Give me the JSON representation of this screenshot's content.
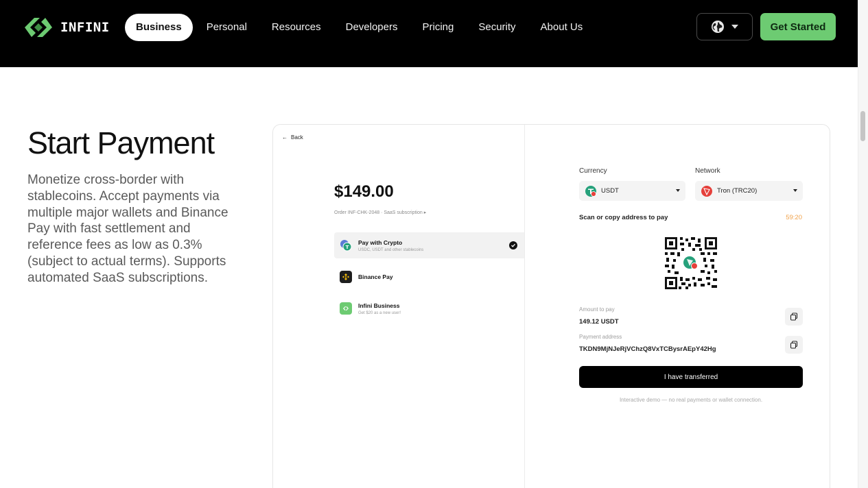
{
  "brand": {
    "name": "INFINI",
    "accent": "#6dcb72"
  },
  "nav": {
    "links": [
      {
        "label": "Business",
        "active": true
      },
      {
        "label": "Personal",
        "active": false
      },
      {
        "label": "Resources",
        "active": false
      },
      {
        "label": "Developers",
        "active": false
      },
      {
        "label": "Pricing",
        "active": false
      },
      {
        "label": "Security",
        "active": false
      },
      {
        "label": "About Us",
        "active": false
      }
    ],
    "language_icon": "globe-icon",
    "cta_label": "Get Started"
  },
  "hero": {
    "title": "Start Payment",
    "description": "Monetize cross-border with stablecoins. Accept payments via multiple major wallets and Binance Pay with fast settlement and reference fees as low as 0.3% (subject to actual terms). Supports automated SaaS subscriptions."
  },
  "demo": {
    "back_label": "Back",
    "price": "$149.00",
    "order": "Order INF-CHK-2048 · SaaS subscription ▸",
    "methods": [
      {
        "title": "Pay with Crypto",
        "subtitle": "USDC, USDT and other stablecoins",
        "icon": "crypto-coins-icon",
        "selected": true
      },
      {
        "title": "Binance Pay",
        "subtitle": "",
        "icon": "binance-icon",
        "selected": false
      },
      {
        "title": "Infini Business",
        "subtitle": "Get $20 as a new user!",
        "icon": "infini-icon",
        "selected": false
      }
    ],
    "currency": {
      "label": "Currency",
      "value": "USDT",
      "icon": "usdt-icon",
      "color": "#26a17b"
    },
    "network": {
      "label": "Network",
      "value": "Tron (TRC20)",
      "icon": "tron-icon",
      "color": "#e5403b"
    },
    "scan_label": "Scan or copy address to pay",
    "timer": "59:20",
    "amount": {
      "label": "Amount to pay",
      "value": "149.12 USDT"
    },
    "address": {
      "label": "Payment address",
      "value": "TKDN9MjNJeRjVChzQ8VxTCBysrAEpY42Hg"
    },
    "transfer_label": "I have transferred",
    "note": "Interactive demo — no real payments or wallet connection."
  }
}
